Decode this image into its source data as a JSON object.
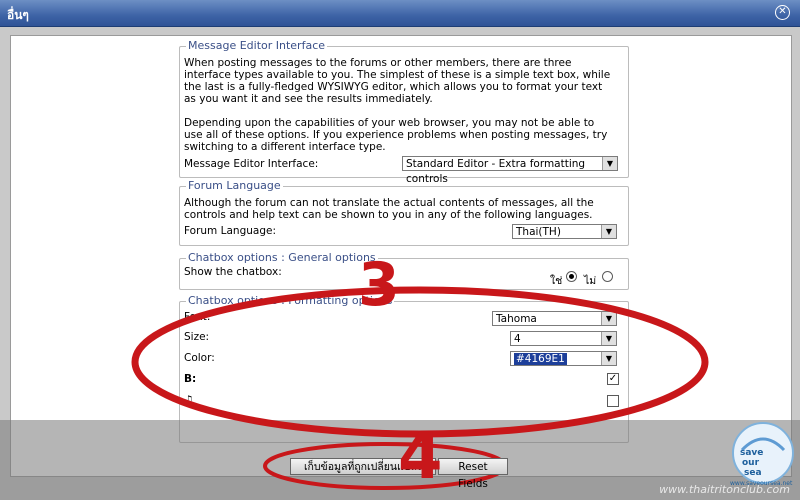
{
  "window": {
    "title": "อื่นๆ"
  },
  "editor": {
    "legend": "Message Editor Interface",
    "desc1": "When posting messages to the forums or other members, there are three interface types available to you. The simplest of these is a simple text box, while the last is a fully-fledged WYSIWYG editor, which allows you to format your text as you want it and see the results immediately.",
    "desc2": "Depending upon the capabilities of your web browser, you may not be able to use all of these options. If you experience problems when posting messages, try switching to a different interface type.",
    "label": "Message Editor Interface:",
    "value": "Standard Editor - Extra formatting controls"
  },
  "language": {
    "legend": "Forum Language",
    "desc": "Although the forum can not translate the actual contents of messages, all the controls and help text can be shown to you in any of the following languages.",
    "label": "Forum Language:",
    "value": "Thai(TH)"
  },
  "chatbox_general": {
    "legend": "Chatbox options : General options",
    "label": "Show the chatbox:",
    "yes_label": "ใช่",
    "no_label": "ไม่",
    "selected": "yes"
  },
  "chatbox_format": {
    "legend": "Chatbox options : Formatting options",
    "font_label": "Font:",
    "font_value": "Tahoma",
    "size_label": "Size:",
    "size_value": "4",
    "color_label": "Color:",
    "color_value": "#4169E1",
    "bold_label": "B:",
    "bold_checked": true,
    "sound_label": "♫",
    "sound_checked": false
  },
  "buttons": {
    "save": "เก็บข้อมูลที่ถูกเปลี่ยนแปลง",
    "reset": "Reset Fields"
  },
  "annotations": {
    "step3": "3",
    "step4": "4",
    "color": "#c8171a"
  },
  "watermark": {
    "site": "www.thaitritonclub.com",
    "logo_line1": "save",
    "logo_line2": "our",
    "logo_line3": "sea",
    "logo_url": "www.saveoursea.net"
  }
}
